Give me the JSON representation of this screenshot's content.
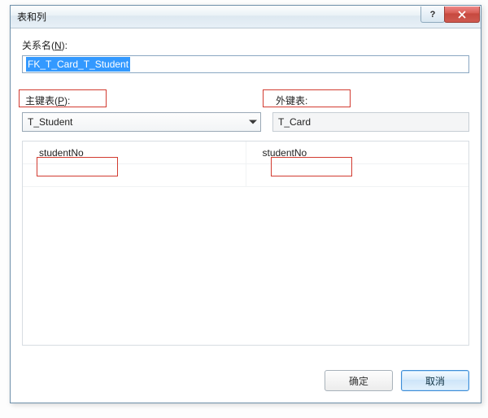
{
  "titlebar": {
    "title": "表和列"
  },
  "relation": {
    "label_prefix": "关系名(",
    "label_hotkey": "N",
    "label_suffix": "):",
    "value": "FK_T_Card_T_Student"
  },
  "pk": {
    "label_prefix": "主键表(",
    "label_hotkey": "P",
    "label_suffix": "):",
    "selected": "T_Student"
  },
  "fk": {
    "label": "外键表:",
    "value": "T_Card"
  },
  "grid": {
    "rows": [
      {
        "pkcol": "studentNo",
        "fkcol": "studentNo"
      }
    ]
  },
  "buttons": {
    "ok": "确定",
    "cancel": "取消"
  }
}
